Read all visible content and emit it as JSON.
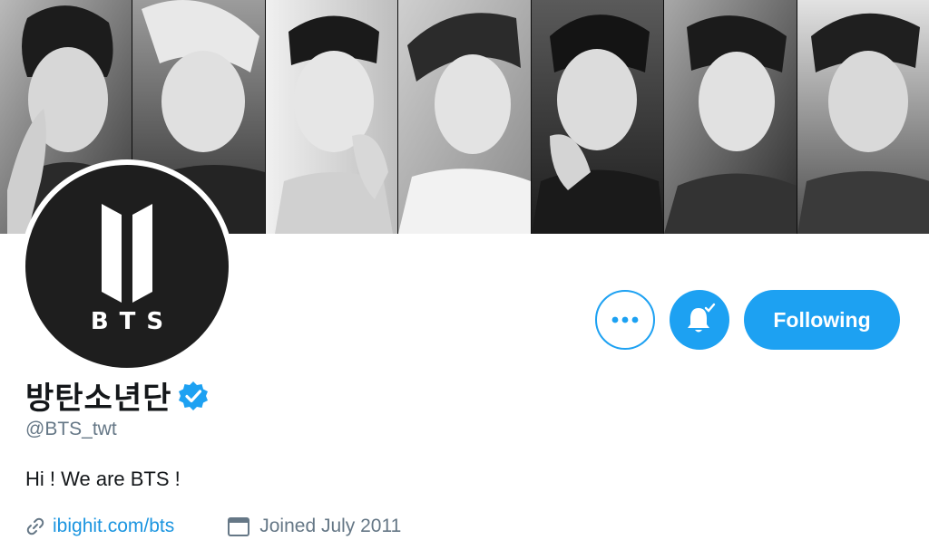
{
  "banner": {
    "alt": "header-photo",
    "members": 7
  },
  "avatar": {
    "brand_text": "BTS"
  },
  "actions": {
    "more_label": "More",
    "notifications_label": "Notifications on",
    "follow_label": "Following"
  },
  "profile": {
    "display_name": "방탄소년단",
    "handle": "@BTS_twt",
    "bio": "Hi ! We are BTS !",
    "website": "ibighit.com/bts",
    "joined": "Joined July 2011"
  },
  "colors": {
    "accent": "#1da1f2",
    "text_primary": "#14171a",
    "text_secondary": "#657786",
    "link": "#1b95e0"
  }
}
